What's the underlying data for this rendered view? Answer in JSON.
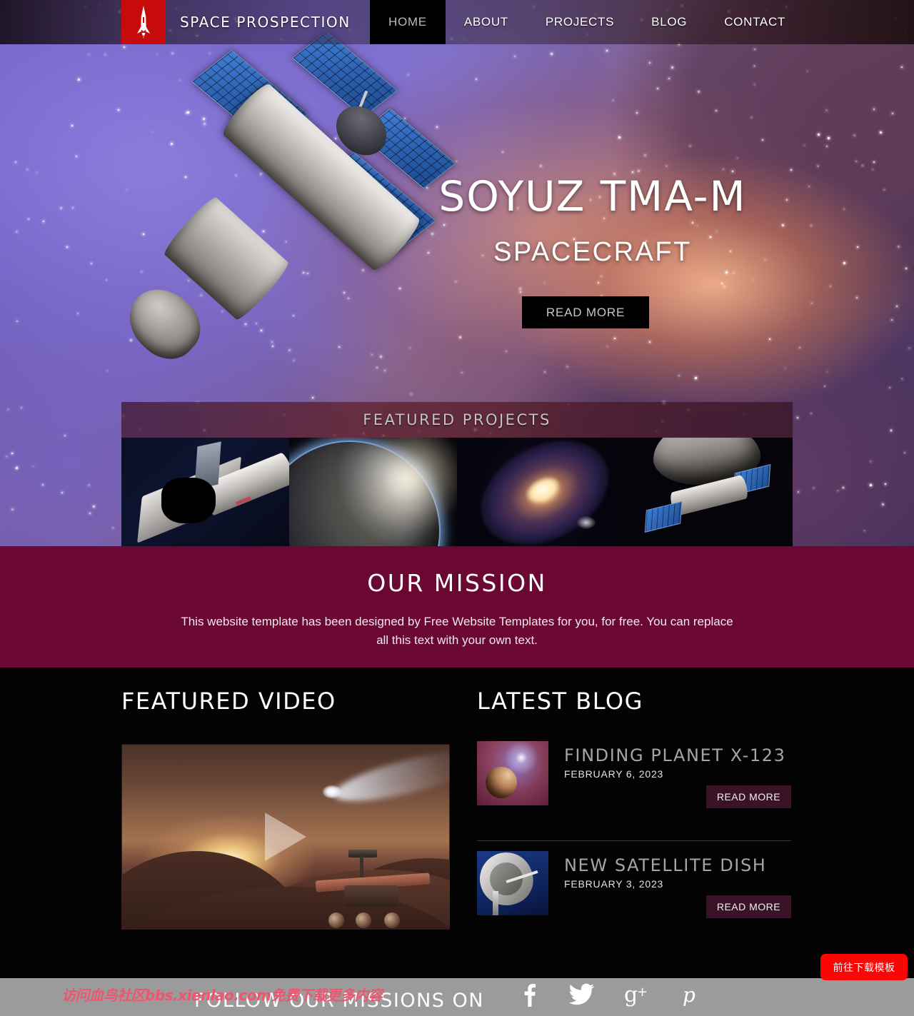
{
  "header": {
    "logo_icon": "rocket-icon",
    "brand": "SPACE PROSPECTION",
    "nav": [
      {
        "label": "HOME",
        "active": true
      },
      {
        "label": "ABOUT",
        "active": false
      },
      {
        "label": "PROJECTS",
        "active": false
      },
      {
        "label": "BLOG",
        "active": false
      },
      {
        "label": "CONTACT",
        "active": false
      }
    ]
  },
  "hero": {
    "title": "SOYUZ TMA-M",
    "subtitle": "SPACECRAFT",
    "button": "READ MORE"
  },
  "featured_projects": {
    "heading": "FEATURED PROJECTS",
    "items": [
      {
        "name": "space-shuttle"
      },
      {
        "name": "earth-from-orbit"
      },
      {
        "name": "spiral-galaxy"
      },
      {
        "name": "asteroid-spacecraft"
      }
    ]
  },
  "mission": {
    "heading": "OUR MISSION",
    "text": "This website template has been designed by Free Website Templates for you, for free. You can replace all this text with your own text."
  },
  "featured_video": {
    "heading": "FEATURED VIDEO",
    "play_icon": "play-icon"
  },
  "latest_blog": {
    "heading": "LATEST BLOG",
    "posts": [
      {
        "title": "FINDING PLANET X-123",
        "date": "FEBRUARY 6, 2023",
        "button": "READ MORE",
        "thumb": "planet-nebula-thumbnail"
      },
      {
        "title": "NEW SATELLITE DISH",
        "date": "FEBRUARY 3, 2023",
        "button": "READ MORE",
        "thumb": "satellite-dish-thumbnail"
      }
    ]
  },
  "footer": {
    "follow_text": "FOLLOW OUR MISSIONS ON",
    "socials": [
      {
        "name": "facebook-icon",
        "glyph": "f"
      },
      {
        "name": "twitter-icon",
        "glyph": "t"
      },
      {
        "name": "google-plus-icon",
        "glyph": "g+"
      },
      {
        "name": "pinterest-icon",
        "glyph": "p"
      }
    ]
  },
  "overlay": {
    "download_button": "前往下载模板",
    "watermark": "访问血鸟社区bbs.xienlao.com免费下载更多内容"
  },
  "colors": {
    "logo_red": "#c70a0a",
    "mission_band": "#6b0733",
    "blog_button": "#3a1328",
    "footer_gray": "#9b9b9b",
    "download_red": "#fc0505",
    "watermark_pink": "#f0556f"
  }
}
